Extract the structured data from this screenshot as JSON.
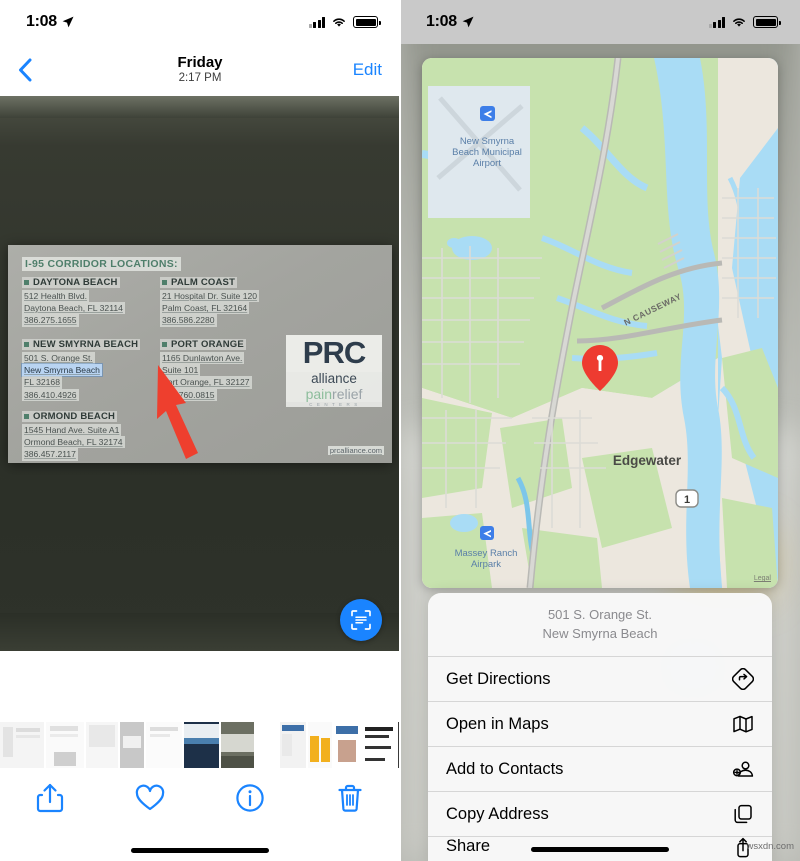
{
  "status_bar": {
    "time": "1:08",
    "location_icon": "location-arrow-icon",
    "signal_icon": "cellular-signal-icon",
    "wifi_icon": "wifi-icon",
    "battery_icon": "battery-icon"
  },
  "left_panel": {
    "nav": {
      "back_icon": "chevron-left-icon",
      "title": "Friday",
      "subtitle": "2:17 PM",
      "edit_label": "Edit"
    },
    "photo": {
      "card_title": "I-95 CORRIDOR LOCATIONS:",
      "locations": [
        {
          "name": "DAYTONA BEACH",
          "lines": [
            "512 Health Blvd.",
            "Daytona Beach, FL 32114",
            "386.275.1655"
          ]
        },
        {
          "name": "PALM COAST",
          "lines": [
            "21 Hospital Dr. Suite 120",
            "Palm Coast, FL 32164",
            "386.586.2280"
          ]
        },
        {
          "name": "NEW SMYRNA BEACH",
          "lines": [
            "501 S. Orange St.",
            "New Smyrna Beach",
            "FL 32168",
            "386.410.4926"
          ],
          "selected_line_index": 1
        },
        {
          "name": "PORT ORANGE",
          "lines": [
            "1165 Dunlawton Ave.",
            "Suite 101",
            "Port Orange, FL 32127",
            "386.760.0815"
          ]
        },
        {
          "name": "ORMOND BEACH",
          "lines": [
            "1545 Hand Ave. Suite A1",
            "Ormond Beach, FL 32174",
            "386.457.2117"
          ]
        }
      ],
      "logo": {
        "mark": "PRC",
        "line1": "alliance",
        "line2_a": "pain",
        "line2_b": "relief",
        "line3": "C E N T E R S",
        "url": "prcalliance.com"
      },
      "annotation_icon": "red-arrow-annotation",
      "scan_button_icon": "live-text-scan-icon"
    },
    "toolbar": [
      {
        "icon": "share-icon",
        "label": "Share"
      },
      {
        "icon": "heart-icon",
        "label": "Favorite"
      },
      {
        "icon": "info-icon",
        "label": "Info"
      },
      {
        "icon": "trash-icon",
        "label": "Delete"
      }
    ],
    "thumbnail_count": 10
  },
  "right_panel": {
    "map": {
      "labels": [
        {
          "text": "New Smyrna",
          "sub1": "Beach Municipal",
          "sub2": "Airport"
        },
        {
          "text": "N CAUSEWAY"
        },
        {
          "text": "Edgewater"
        },
        {
          "text": "Massey Ranch",
          "sub1": "Airpark"
        }
      ],
      "airport_icon": "airplane-icon",
      "pin_icon": "map-pin-icon",
      "route_shield": "1",
      "legal_label": "Legal"
    },
    "action_sheet": {
      "header_line1": "501 S. Orange St.",
      "header_line2": "New Smyrna Beach",
      "items": [
        {
          "label": "Get Directions",
          "icon": "directions-icon"
        },
        {
          "label": "Open in Maps",
          "icon": "map-icon"
        },
        {
          "label": "Add to Contacts",
          "icon": "add-contact-icon"
        },
        {
          "label": "Copy Address",
          "icon": "copy-icon"
        },
        {
          "label": "Share",
          "icon": "share-icon"
        }
      ]
    }
  },
  "watermark": "wsxdn.com",
  "colors": {
    "accent_blue": "#1a84ff",
    "pin_red": "#ee3b30",
    "map_green": "#c7e2ae",
    "map_water": "#a9dcf5",
    "card_gray": "#a8a9a4",
    "arrow_red": "#ee3f2e"
  }
}
